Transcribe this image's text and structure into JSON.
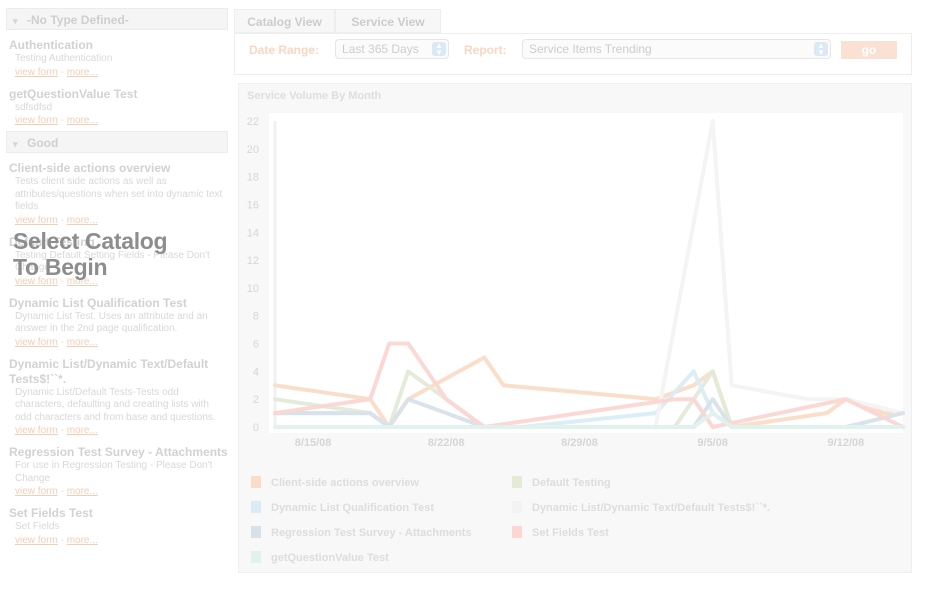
{
  "sidebar": {
    "groups": [
      {
        "label": "-No Type Defined-",
        "items": [
          {
            "title": "Authentication",
            "description": "Testing Authentication",
            "view_link": "view form",
            "more_link": "more..."
          },
          {
            "title": "getQuestionValue Test",
            "description": "sdfsdfsd",
            "view_link": "view form",
            "more_link": "more..."
          }
        ]
      },
      {
        "label": "Good",
        "items": [
          {
            "title": "Client-side actions overview",
            "description": "Tests client side actions as well as attributes/questions when set into dynamic text fields",
            "view_link": "view form",
            "more_link": "more..."
          },
          {
            "title": "Default Testing",
            "description": "Testing Default Setting Fields - Please Don't Change",
            "view_link": "view form",
            "more_link": "more..."
          },
          {
            "title": "Dynamic List Qualification Test",
            "description": "Dynamic List Test. Uses an attribute and an answer in the 2nd page qualification.",
            "view_link": "view form",
            "more_link": "more..."
          },
          {
            "title": "Dynamic List/Dynamic Text/Default Tests$!``*.",
            "description": "Dynamic List/Default Tests-Tests odd characters, defaulting and creating lists with odd characters and from base and questions.",
            "view_link": "view form",
            "more_link": "more..."
          },
          {
            "title": "Regression Test Survey - Attachments",
            "description": "For use in Regression Testing - Please Don't Change",
            "view_link": "view form",
            "more_link": "more..."
          },
          {
            "title": "Set Fields Test",
            "description": "Set Fields",
            "view_link": "view form",
            "more_link": "more..."
          }
        ]
      }
    ],
    "link_separator": "-"
  },
  "overlay_message": [
    "Select Catalog",
    "To Begin"
  ],
  "tabs": [
    {
      "label": "Catalog View",
      "active": true
    },
    {
      "label": "Service View",
      "active": false
    }
  ],
  "filters": {
    "date_range_label": "Date Range:",
    "date_range_value": "Last 365 Days",
    "report_label": "Report:",
    "report_value": "Service Items Trending",
    "go_label": "go"
  },
  "colors": {
    "accent": "#f8d7c1",
    "panel_bg": "#f8f8f8",
    "overlay_text": "#8d8d8d"
  },
  "chart_data": {
    "type": "line",
    "title": "Service Volume By Month",
    "xlabel": "",
    "ylabel": "",
    "x_tick_labels": [
      "8/15/08",
      "8/22/08",
      "8/29/08",
      "9/5/08",
      "9/12/08"
    ],
    "x_start": "2008-08-13",
    "x_end": "2008-09-15",
    "ylim": [
      0,
      22
    ],
    "y_ticks": [
      0,
      2,
      4,
      6,
      8,
      10,
      12,
      14,
      16,
      18,
      20,
      22
    ],
    "legend_position": "bottom",
    "series": [
      {
        "name": "Client-side actions overview",
        "color": "#fbdcc6",
        "points": [
          [
            "2008-08-13",
            3
          ],
          [
            "2008-08-18",
            2
          ],
          [
            "2008-08-19",
            0
          ],
          [
            "2008-08-20",
            2
          ],
          [
            "2008-08-24",
            5
          ],
          [
            "2008-08-25",
            3
          ],
          [
            "2008-09-02",
            2
          ],
          [
            "2008-09-04",
            3
          ],
          [
            "2008-09-05",
            4
          ],
          [
            "2008-09-06",
            0
          ],
          [
            "2008-09-11",
            1
          ],
          [
            "2008-09-12",
            2
          ],
          [
            "2008-09-14",
            1
          ],
          [
            "2008-09-15",
            1
          ]
        ]
      },
      {
        "name": "Default Testing",
        "color": "#e3ead6",
        "points": [
          [
            "2008-08-13",
            2
          ],
          [
            "2008-08-18",
            1
          ],
          [
            "2008-08-19",
            0
          ],
          [
            "2008-08-20",
            4
          ],
          [
            "2008-08-22",
            2
          ],
          [
            "2008-08-24",
            0
          ],
          [
            "2008-09-03",
            0
          ],
          [
            "2008-09-05",
            4
          ],
          [
            "2008-09-06",
            0
          ],
          [
            "2008-09-15",
            0
          ]
        ]
      },
      {
        "name": "Dynamic List  Qualification Test",
        "color": "#d9ecf6",
        "points": [
          [
            "2008-08-13",
            1
          ],
          [
            "2008-08-18",
            1
          ],
          [
            "2008-08-19",
            0
          ],
          [
            "2008-08-26",
            0
          ],
          [
            "2008-09-02",
            1
          ],
          [
            "2008-09-04",
            4
          ],
          [
            "2008-09-05",
            1
          ],
          [
            "2008-09-06",
            0
          ],
          [
            "2008-09-15",
            0
          ]
        ]
      },
      {
        "name": "Dynamic List/Dynamic Text/Default Tests$!``*.",
        "color": "#f3f3f3",
        "points": [
          [
            "2008-08-13",
            0
          ],
          [
            "2008-09-02",
            0
          ],
          [
            "2008-09-05",
            22
          ],
          [
            "2008-09-06",
            3
          ],
          [
            "2008-09-10",
            2
          ],
          [
            "2008-09-12",
            2
          ],
          [
            "2008-09-15",
            1
          ]
        ]
      },
      {
        "name": "Regression Test Survey - Attachments",
        "color": "#d8e1ea",
        "points": [
          [
            "2008-08-13",
            1
          ],
          [
            "2008-08-18",
            1
          ],
          [
            "2008-08-19",
            0
          ],
          [
            "2008-08-20",
            2
          ],
          [
            "2008-08-22",
            1
          ],
          [
            "2008-08-24",
            0
          ],
          [
            "2008-09-04",
            0
          ],
          [
            "2008-09-05",
            2
          ],
          [
            "2008-09-06",
            0
          ],
          [
            "2008-09-12",
            0
          ],
          [
            "2008-09-15",
            1
          ]
        ]
      },
      {
        "name": "Set Fields Test",
        "color": "#fbd6d2",
        "points": [
          [
            "2008-08-13",
            1
          ],
          [
            "2008-08-18",
            2
          ],
          [
            "2008-08-19",
            6
          ],
          [
            "2008-08-20",
            6
          ],
          [
            "2008-08-22",
            2
          ],
          [
            "2008-08-24",
            0
          ],
          [
            "2008-09-03",
            2
          ],
          [
            "2008-09-04",
            2
          ],
          [
            "2008-09-05",
            0
          ],
          [
            "2008-09-12",
            2
          ],
          [
            "2008-09-15",
            0
          ]
        ]
      },
      {
        "name": "getQuestionValue Test",
        "color": "#e0f1ee",
        "points": [
          [
            "2008-08-13",
            0
          ],
          [
            "2008-09-04",
            0
          ],
          [
            "2008-09-05",
            1
          ],
          [
            "2008-09-06",
            0
          ],
          [
            "2008-09-15",
            0
          ]
        ]
      }
    ]
  }
}
